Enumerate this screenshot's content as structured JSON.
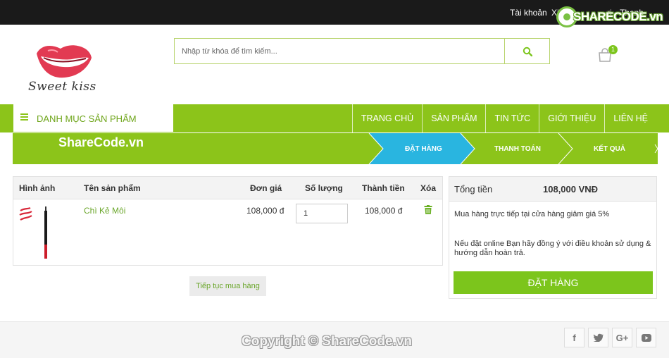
{
  "topbar": {
    "account": "Tài khoản",
    "register": "Xin",
    "register_tail": "ri",
    "checkout": "Thanh"
  },
  "watermark": {
    "badge": "SHARECODE.vn",
    "banner": "ShareCode.vn",
    "footer": "Copyright © ShareCode.vn"
  },
  "logo": {
    "text": "Sweet kiss"
  },
  "search": {
    "placeholder": "Nhập từ khóa để tìm kiếm..."
  },
  "cart": {
    "count": "1"
  },
  "nav": {
    "category_label": "DANH MỤC SẢN PHẨM",
    "items": [
      "TRANG CHỦ",
      "SẢN PHẨM",
      "TIN TỨC",
      "GIỚI THIỆU",
      "LIÊN HỆ"
    ]
  },
  "steps": {
    "items": [
      "ĐẶT HÀNG",
      "THANH TOÁN",
      "KẾT QUẢ"
    ],
    "active_color": "#29b5e0",
    "bar_color": "#8cc41a"
  },
  "table": {
    "headers": [
      "Hình ảnh",
      "Tên sản phẩm",
      "Đơn giá",
      "Số lượng",
      "Thành tiền",
      "Xóa"
    ],
    "rows": [
      {
        "name": "Chì Kẻ Môi",
        "price": "108,000 đ",
        "quantity": "1",
        "total": "108,000 đ"
      }
    ],
    "continue_label": "Tiếp tục mua hàng"
  },
  "summary": {
    "label": "Tổng tiền",
    "total": "108,000 VNĐ",
    "note1": "Mua hàng trực tiếp tại cửa hàng giảm giá 5%",
    "note2a": "Nếu đặt online Bạn hãy đồng ý với điều khoản sử dụng &",
    "note2b": "hướng dẫn hoàn trả.",
    "order_label": "ĐẶT HÀNG"
  },
  "footer": {
    "social": [
      "f",
      "t",
      "G+",
      "yt"
    ]
  },
  "colors": {
    "accent": "#8cc41a",
    "button": "#7cc51c",
    "link": "#6aa62a"
  }
}
